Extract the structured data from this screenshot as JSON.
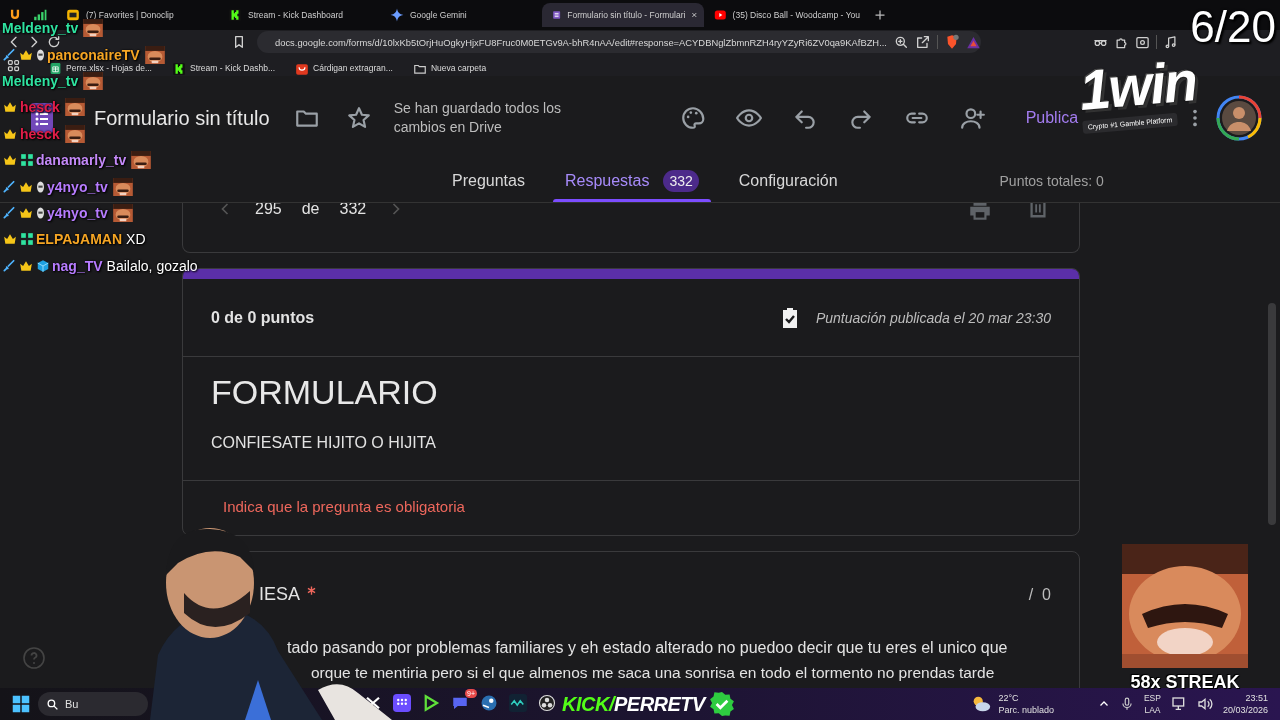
{
  "browser": {
    "tabs": [
      {
        "label": "(7) Favorites | Donoclip",
        "kind": "donoclip",
        "selected": false
      },
      {
        "label": "Stream - Kick Dashboard",
        "kind": "kick",
        "selected": false
      },
      {
        "label": "Google Gemini",
        "kind": "gemini",
        "selected": false
      },
      {
        "label": "Formulario sin título - Formulari",
        "kind": "forms",
        "selected": true
      },
      {
        "label": "(35) Disco Ball - Woodcamp - You",
        "kind": "youtube",
        "selected": false
      }
    ],
    "address": "docs.google.com/forms/d/10lxKb5tOrjHuOgkyHjxFU8Fruc0M0ETGv9A-bhR4nAA/edit#response=ACYDBNglZbmnRZH4ryYZyRi6ZV0qa9KAfBZH...",
    "bookmarks": [
      {
        "label": "Perre.xlsx - Hojas de...",
        "kind": "sheets"
      },
      {
        "label": "Stream - Kick Dashb...",
        "kind": "kick"
      },
      {
        "label": "Cárdigan extragran...",
        "kind": "shop"
      },
      {
        "label": "Nueva carpeta",
        "kind": "folder"
      }
    ]
  },
  "form_header": {
    "title": "Formulario sin título",
    "save_status": "Se han guardado todos los cambios en Drive",
    "publish": "Publica"
  },
  "form_tabs": [
    {
      "label": "Preguntas",
      "selected": false
    },
    {
      "label": "Respuestas",
      "selected": true,
      "count": "332"
    },
    {
      "label": "Configuración",
      "selected": false
    }
  ],
  "total_points": "Puntos totales: 0",
  "pager": {
    "current": "295",
    "separator": "de",
    "total": "332"
  },
  "response": {
    "score": "0 de 0 puntos",
    "published": "Puntuación publicada el 20 mar 23:30",
    "form_title": "FORMULARIO",
    "description": "CONFIESATE HIJITO O HIJITA",
    "required_note": "Indica que la pregunta es obligatoria"
  },
  "question": {
    "title": "IESA",
    "required": true,
    "points": "/  0",
    "answer_lines": [
      "tado pasando por problemas familiares y eh estado alterado no puedoo decir que tu eres el unico que",
      "orque te mentiria pero si el que almenos me saca una sonrisa en todo el tormento no prendas tarde"
    ]
  },
  "chat": [
    {
      "user": "Meldeny_tv",
      "color": "#2fe3a0",
      "kind": "emote"
    },
    {
      "user": "panconaireTV",
      "color": "#f5a524",
      "badges": [
        {
          "kind": "sword"
        },
        {
          "kind": "crown"
        },
        {
          "kind": "helmet"
        }
      ],
      "kind": "emote"
    },
    {
      "user": "Meldeny_tv",
      "color": "#2fe3a0",
      "kind": "emote"
    },
    {
      "user": "hesck",
      "color": "#e11d48",
      "badges": [
        {
          "kind": "crown"
        }
      ],
      "kind": "emote"
    },
    {
      "user": "hesck",
      "color": "#e11d48",
      "badges": [
        {
          "kind": "crown"
        }
      ],
      "kind": "emote"
    },
    {
      "user": "danamarly_tv",
      "color": "#c58af9",
      "badges": [
        {
          "kind": "crown"
        },
        {
          "kind": "grid"
        }
      ],
      "kind": "emote"
    },
    {
      "user": "y4nyo_tv",
      "color": "#b77cff",
      "badges": [
        {
          "kind": "sword"
        },
        {
          "kind": "crown"
        },
        {
          "kind": "helmet"
        }
      ],
      "kind": "emote"
    },
    {
      "user": "y4nyo_tv",
      "color": "#b77cff",
      "badges": [
        {
          "kind": "sword"
        },
        {
          "kind": "crown"
        },
        {
          "kind": "helmet"
        }
      ],
      "kind": "emote"
    },
    {
      "user": "ELPAJAMAN",
      "color": "#f5a524",
      "badges": [
        {
          "kind": "crown"
        },
        {
          "kind": "grid"
        }
      ],
      "kind": "text",
      "message": "XD"
    },
    {
      "user": "nag_TV",
      "color": "#b77cff",
      "badges": [
        {
          "kind": "sword"
        },
        {
          "kind": "crown"
        },
        {
          "kind": "cube"
        }
      ],
      "kind": "text",
      "message": "Bailalo, gozalo"
    }
  ],
  "overlay": {
    "counter": "6/20",
    "sponsor_logo": "1win",
    "sponsor_tagline": "Crypto #1 Gamble Platform",
    "streak": "58x STREAK",
    "kick_brand": "KICK/",
    "channel": "PERRETV"
  },
  "taskbar": {
    "search": "Bu",
    "apps": [
      {
        "kind": "capcut"
      },
      {
        "kind": "dots"
      },
      {
        "kind": "play"
      },
      {
        "kind": "chat",
        "badge": "9+"
      },
      {
        "kind": "steam"
      },
      {
        "kind": "wave"
      },
      {
        "kind": "obs"
      }
    ],
    "weather_temp": "22°C",
    "weather_desc": "Parc. nublado",
    "language": "ESP",
    "layout": "LAA",
    "time": "23:51",
    "date": "20/03/2026"
  }
}
